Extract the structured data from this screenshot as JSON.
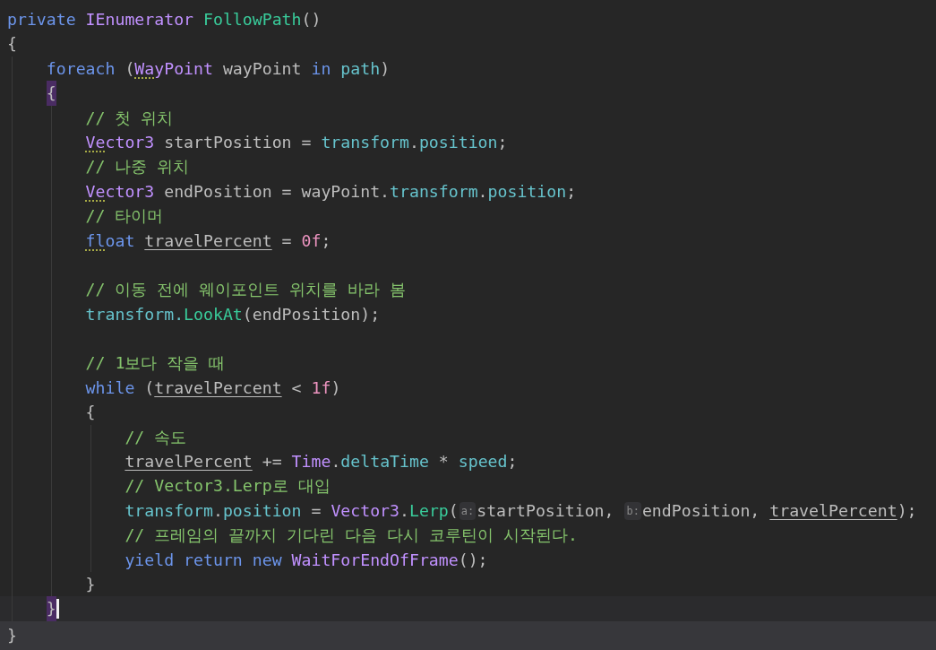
{
  "editor": {
    "lines": [
      {
        "current": false,
        "tokens": [
          {
            "text": "private ",
            "kind": "keyword"
          },
          {
            "text": "IEnumerator ",
            "kind": "type"
          },
          {
            "text": "FollowPath",
            "kind": "method"
          },
          {
            "text": "()",
            "kind": "text"
          }
        ]
      },
      {
        "current": false,
        "tokens": [
          {
            "text": "{",
            "kind": "text"
          }
        ],
        "children": [
          {
            "current": false,
            "tokens": [
              {
                "text": "foreach ",
                "kind": "keyword"
              },
              {
                "text": "(",
                "kind": "text"
              },
              {
                "text": "Wa",
                "kind": "type-flagged"
              },
              {
                "text": "yPoint",
                "kind": "type"
              },
              {
                "text": " wayPoint ",
                "kind": "text"
              },
              {
                "text": "in ",
                "kind": "keyword"
              },
              {
                "text": "path",
                "kind": "member"
              },
              {
                "text": ")",
                "kind": "text"
              }
            ]
          },
          {
            "current": false,
            "tokens": [
              {
                "text": "{",
                "kind": "brace-matched"
              }
            ],
            "children": [
              {
                "current": false,
                "tokens": [
                  {
                    "text": "// 첫 위치",
                    "kind": "comment"
                  }
                ]
              },
              {
                "current": false,
                "tokens": [
                  {
                    "text": "Ve",
                    "kind": "type-flagged"
                  },
                  {
                    "text": "ctor3",
                    "kind": "type"
                  },
                  {
                    "text": " startPosition = ",
                    "kind": "text"
                  },
                  {
                    "text": "transform",
                    "kind": "member"
                  },
                  {
                    "text": ".",
                    "kind": "text"
                  },
                  {
                    "text": "position",
                    "kind": "member"
                  },
                  {
                    "text": ";",
                    "kind": "text"
                  }
                ]
              },
              {
                "current": false,
                "tokens": [
                  {
                    "text": "// 나중 위치",
                    "kind": "comment"
                  }
                ]
              },
              {
                "current": false,
                "tokens": [
                  {
                    "text": "Ve",
                    "kind": "type-flagged"
                  },
                  {
                    "text": "ctor3",
                    "kind": "type"
                  },
                  {
                    "text": " endPosition = wayPoint.",
                    "kind": "text"
                  },
                  {
                    "text": "transform",
                    "kind": "member"
                  },
                  {
                    "text": ".",
                    "kind": "text"
                  },
                  {
                    "text": "position",
                    "kind": "member"
                  },
                  {
                    "text": ";",
                    "kind": "text"
                  }
                ]
              },
              {
                "current": false,
                "tokens": [
                  {
                    "text": "// 타이머",
                    "kind": "comment"
                  }
                ]
              },
              {
                "current": false,
                "tokens": [
                  {
                    "text": "fl",
                    "kind": "keyword-flagged"
                  },
                  {
                    "text": "oat ",
                    "kind": "keyword"
                  },
                  {
                    "text": "travelPercent",
                    "kind": "variable-mutable"
                  },
                  {
                    "text": " = ",
                    "kind": "text"
                  },
                  {
                    "text": "0f",
                    "kind": "number"
                  },
                  {
                    "text": ";",
                    "kind": "text"
                  }
                ]
              },
              {
                "kind": "blank"
              },
              {
                "current": false,
                "tokens": [
                  {
                    "text": "// 이동 전에 웨이포인트 위치를 바라 봄",
                    "kind": "comment"
                  }
                ]
              },
              {
                "current": false,
                "tokens": [
                  {
                    "text": "transform.",
                    "kind": "member"
                  },
                  {
                    "text": "LookAt",
                    "kind": "method"
                  },
                  {
                    "text": "(endPosition);",
                    "kind": "text"
                  }
                ]
              },
              {
                "kind": "blank"
              },
              {
                "current": false,
                "tokens": [
                  {
                    "text": "// 1보다 작을 때",
                    "kind": "comment"
                  }
                ]
              },
              {
                "current": false,
                "tokens": [
                  {
                    "text": "while ",
                    "kind": "keyword"
                  },
                  {
                    "text": "(",
                    "kind": "text"
                  },
                  {
                    "text": "travelPercent",
                    "kind": "variable-mutable"
                  },
                  {
                    "text": " < ",
                    "kind": "text"
                  },
                  {
                    "text": "1f",
                    "kind": "number"
                  },
                  {
                    "text": ")",
                    "kind": "text"
                  }
                ]
              },
              {
                "current": false,
                "tokens": [
                  {
                    "text": "{",
                    "kind": "text"
                  }
                ],
                "children": [
                  {
                    "current": false,
                    "tokens": [
                      {
                        "text": "// 속도",
                        "kind": "comment"
                      }
                    ]
                  },
                  {
                    "current": false,
                    "tokens": [
                      {
                        "text": "travelPercent",
                        "kind": "variable-mutable"
                      },
                      {
                        "text": " += ",
                        "kind": "text"
                      },
                      {
                        "text": "Time",
                        "kind": "type"
                      },
                      {
                        "text": ".",
                        "kind": "text"
                      },
                      {
                        "text": "deltaTime",
                        "kind": "member"
                      },
                      {
                        "text": " * ",
                        "kind": "text"
                      },
                      {
                        "text": "speed",
                        "kind": "member"
                      },
                      {
                        "text": ";",
                        "kind": "text"
                      }
                    ]
                  },
                  {
                    "current": false,
                    "tokens": [
                      {
                        "text": "// Vector3.Lerp로 대입",
                        "kind": "comment"
                      }
                    ]
                  },
                  {
                    "current": false,
                    "tokens": [
                      {
                        "text": "transform",
                        "kind": "member"
                      },
                      {
                        "text": ".",
                        "kind": "text"
                      },
                      {
                        "text": "position",
                        "kind": "member"
                      },
                      {
                        "text": " = ",
                        "kind": "text"
                      },
                      {
                        "text": "Vector3",
                        "kind": "type"
                      },
                      {
                        "text": ".",
                        "kind": "text"
                      },
                      {
                        "text": "Lerp",
                        "kind": "method"
                      },
                      {
                        "text": "(",
                        "kind": "text"
                      },
                      {
                        "text": "a:",
                        "kind": "hint"
                      },
                      {
                        "text": "startPosition, ",
                        "kind": "text"
                      },
                      {
                        "text": "b:",
                        "kind": "hint"
                      },
                      {
                        "text": "endPosition, ",
                        "kind": "text"
                      },
                      {
                        "text": "travelPercent",
                        "kind": "variable-mutable"
                      },
                      {
                        "text": ");",
                        "kind": "text"
                      }
                    ]
                  },
                  {
                    "current": false,
                    "tokens": [
                      {
                        "text": "// 프레임의 끝까지 기다린 다음 다시 코루틴이 시작된다.",
                        "kind": "comment"
                      }
                    ]
                  },
                  {
                    "current": false,
                    "tokens": [
                      {
                        "text": "yield return new ",
                        "kind": "keyword"
                      },
                      {
                        "text": "WaitForEndOfFrame",
                        "kind": "type"
                      },
                      {
                        "text": "();",
                        "kind": "text"
                      }
                    ]
                  }
                ]
              },
              {
                "current": false,
                "tokens": [
                  {
                    "text": "}",
                    "kind": "text"
                  }
                ]
              }
            ]
          },
          {
            "current": true,
            "tokens": [
              {
                "text": "}",
                "kind": "brace-matched"
              }
            ]
          }
        ]
      },
      {
        "current": false,
        "tokens": [
          {
            "text": "}",
            "kind": "text"
          }
        ]
      }
    ]
  }
}
